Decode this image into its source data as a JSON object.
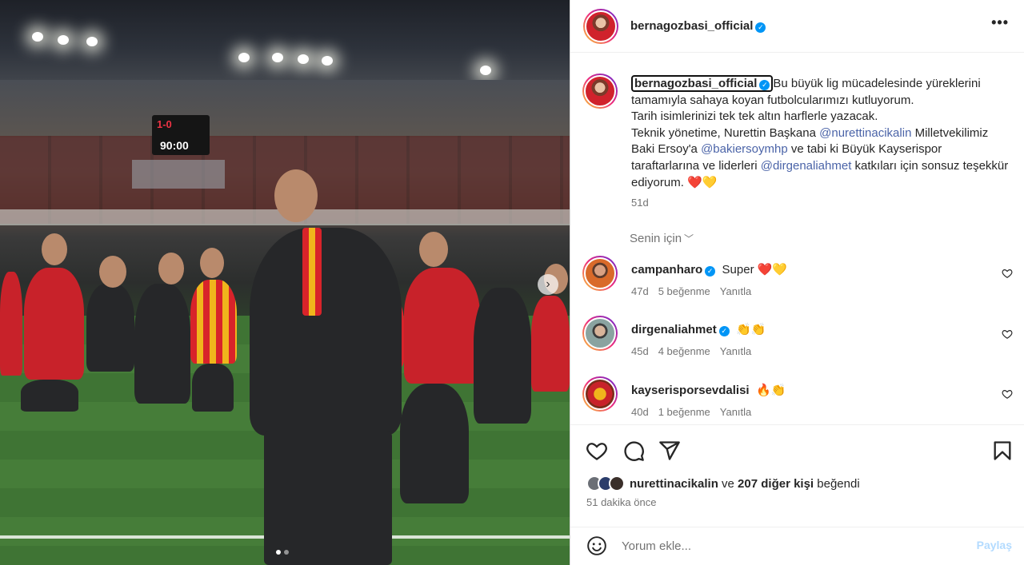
{
  "post": {
    "author": "bernagozbasi_official",
    "more_icon": "more-horizontal-icon"
  },
  "caption": {
    "author": "bernagozbasi_official",
    "text_1": "Bu büyük lig mücadelesinde yüreklerini tamamıyla sahaya koyan futbolcularımızı kutluyorum.",
    "text_2": "Tarih isimlerinizi tek tek altın harflerle yazacak.",
    "text_3": "Teknik yönetime, Nurettin Başkana ",
    "mention_1": "@nurettinacikalin",
    "text_4": " Milletvekilimiz Baki Ersoy'a ",
    "mention_2": "@bakiersoymhp",
    "text_5": " ve tabi ki Büyük Kayserispor taraftarlarına ve liderleri ",
    "mention_3": "@dirgenaliahmet",
    "text_6": " katkıları için sonsuz teşekkür ediyorum. ",
    "emojis": "❤️💛",
    "time": "51d"
  },
  "for_you": "Senin için",
  "comments": [
    {
      "user": "campanharo",
      "text": "Super ❤️💛",
      "time": "47d",
      "likes": "5 beğenme",
      "reply": "Yanıtla"
    },
    {
      "user": "dirgenaliahmet",
      "text": "👏👏",
      "time": "45d",
      "likes": "4 beğenme",
      "reply": "Yanıtla"
    },
    {
      "user": "kayserisporsevdalisi",
      "text": "🔥👏",
      "time": "40d",
      "likes": "1 beğenme",
      "reply": "Yanıtla"
    }
  ],
  "likes": {
    "user": "nurettinacikalin",
    "connector": " ve ",
    "others": "207 diğer kişi",
    "suffix": " beğendi"
  },
  "post_time": "51 dakika önce",
  "add_comment": {
    "placeholder": "Yorum ekle...",
    "post_label": "Paylaş"
  },
  "photo": {
    "score": "1-0",
    "clock": "90:00",
    "slide_current": 1,
    "slide_total": 2
  },
  "colors": {
    "verified": "#0095f6",
    "mention": "#4b64a8",
    "heart_red": "#ed4956",
    "kayseri_red": "#c8222a",
    "kayseri_yellow": "#f0b51c"
  }
}
